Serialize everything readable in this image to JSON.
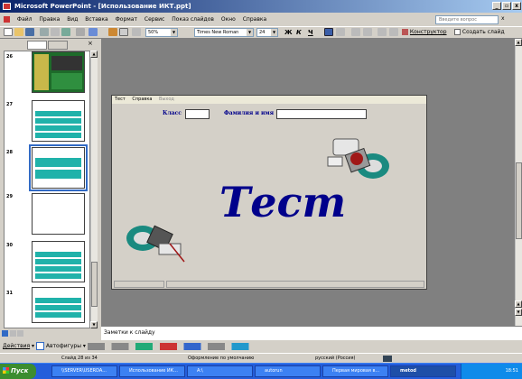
{
  "window": {
    "title": "Microsoft PowerPoint - [Использование ИКТ.ppt]",
    "min": "_",
    "max": "▫",
    "close": "x"
  },
  "menu": [
    "Файл",
    "Правка",
    "Вид",
    "Вставка",
    "Формат",
    "Сервис",
    "Показ слайдов",
    "Окно",
    "Справка"
  ],
  "help_placeholder": "Введите вопрос",
  "toolbar": {
    "zoom": "50%",
    "font": "Times New Roman",
    "size": "24",
    "bold": "Ж",
    "italic": "К",
    "underline": "Ч",
    "design": "Конструктор",
    "new_slide": "Создать слайд"
  },
  "slides": [
    {
      "num": "26",
      "type": "photo"
    },
    {
      "num": "27",
      "type": "teal"
    },
    {
      "num": "28",
      "type": "teal-selected"
    },
    {
      "num": "29",
      "type": "blank"
    },
    {
      "num": "30",
      "type": "teal"
    },
    {
      "num": "31",
      "type": "teal"
    }
  ],
  "slide_window": {
    "menu": [
      "Тест",
      "Справка",
      "Выход"
    ],
    "class_label": "Класс",
    "name_label": "Фамилия и имя",
    "big_text": "Тест"
  },
  "notes_placeholder": "Заметки к слайду",
  "drawing": {
    "actions": "Действия",
    "autoshapes": "Автофигуры"
  },
  "status": {
    "slide": "Слайд 28 из 34",
    "design": "Оформление по умолчанию",
    "lang": "русский (Россия)"
  },
  "taskbar": {
    "start": "Пуск",
    "items": [
      "\\\\SERVER\\USERDA...",
      "Использование ИК...",
      "A:\\",
      "autorun",
      "Первая мировая в...",
      "metod"
    ],
    "time": "18:51"
  }
}
